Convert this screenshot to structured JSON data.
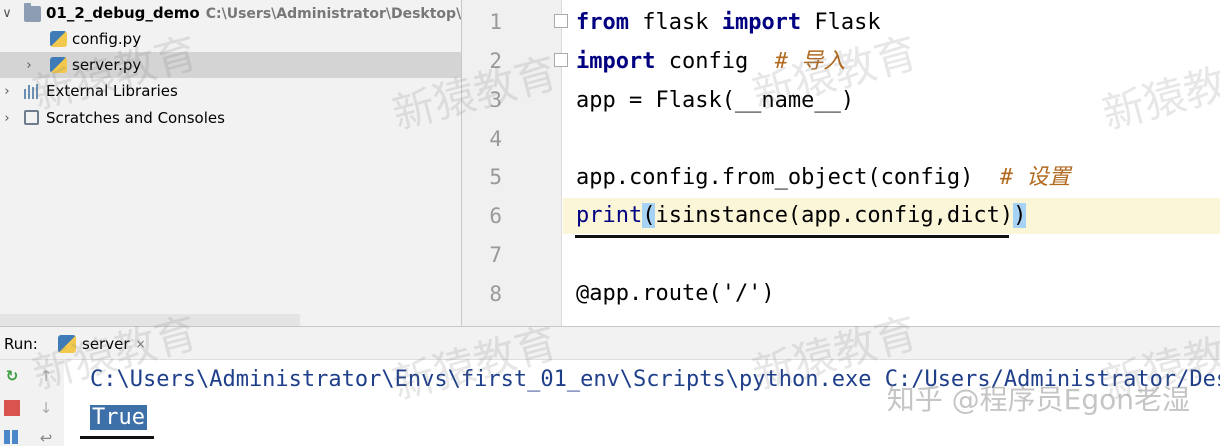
{
  "project": {
    "root_name": "01_2_debug_demo",
    "root_path": "C:\\Users\\Administrator\\Desktop\\clas",
    "files": [
      {
        "name": "config.py"
      },
      {
        "name": "server.py"
      }
    ],
    "external_libraries": "External Libraries",
    "scratches": "Scratches and Consoles"
  },
  "editor": {
    "line_numbers": [
      "1",
      "2",
      "3",
      "4",
      "5",
      "6",
      "7",
      "8"
    ],
    "lines": {
      "l1": {
        "kw1": "from",
        "t1": " flask ",
        "kw2": "import",
        "t2": " Flask"
      },
      "l2": {
        "kw1": "import",
        "t1": " config  ",
        "comment": "# 导入"
      },
      "l3": {
        "text": "app = Flask(__name__)"
      },
      "l5": {
        "text": "app.config.from_object(config)  ",
        "comment": "# 设置"
      },
      "l6": {
        "fn": "print",
        "p1": "(",
        "mid": "isinstance(app.config,dict)",
        "p2": ")"
      },
      "l8": {
        "text": "@app.route('/')"
      }
    },
    "current_line": "6"
  },
  "run": {
    "label": "Run:",
    "tab_label": "server",
    "tab_close": "×",
    "output_line1": "C:\\Users\\Administrator\\Envs\\first_01_env\\Scripts\\python.exe C:/Users/Administrator/Desk",
    "output_result": "True"
  },
  "icons": {
    "expanded": "chevron-down-icon",
    "collapsed": "chevron-right-icon",
    "rerun": "rerun-icon",
    "stop": "stop-icon",
    "up": "arrow-up-icon",
    "down": "arrow-down-icon",
    "wrap": "soft-wrap-icon"
  },
  "watermark": {
    "text": "新猿教育",
    "footer": "知乎 @程序员Egon老湿"
  },
  "colors": {
    "keyword": "#000080",
    "comment": "#b26a20",
    "current_line_bg": "#fbf6d8",
    "brace_highlight": "#a6d2f5",
    "selected_output_bg": "#3d6fa8",
    "console_text": "#1f3f8a",
    "rerun_green": "#3c9d3c",
    "stop_red": "#d9534f"
  }
}
